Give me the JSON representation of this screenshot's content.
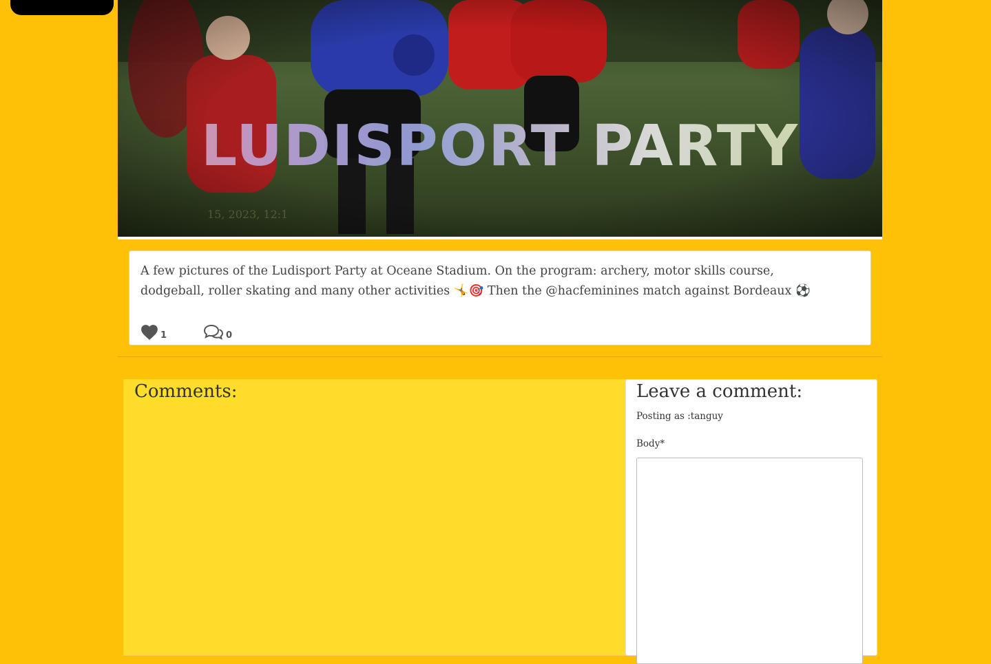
{
  "hero": {
    "title": "LUDISPORT PARTY",
    "date": "15, 2023, 12:1",
    "image_alt": "kids-playing-soccer-photo"
  },
  "post": {
    "body_text": "A few pictures of the Ludisport Party at Oceane Stadium. On the program: archery, motor skills course, dodgeball, roller skating and many other activities ",
    "emoji_1": "🤸",
    "emoji_2": "🎯",
    "body_text_2": " Then the @hacfeminines match against Bordeaux ",
    "emoji_3": "⚽",
    "likes": "1",
    "comments_count": "0"
  },
  "comments": {
    "heading": "Comments:"
  },
  "leave_comment": {
    "heading": "Leave a comment:",
    "posting_as": "Posting as :tanguy",
    "body_label": "Body*",
    "body_value": ""
  },
  "colors": {
    "page_bg": "#ffc107",
    "comments_bg": "#ffdd2b",
    "card_bg": "#ffffff",
    "nav_bg": "#000000"
  }
}
